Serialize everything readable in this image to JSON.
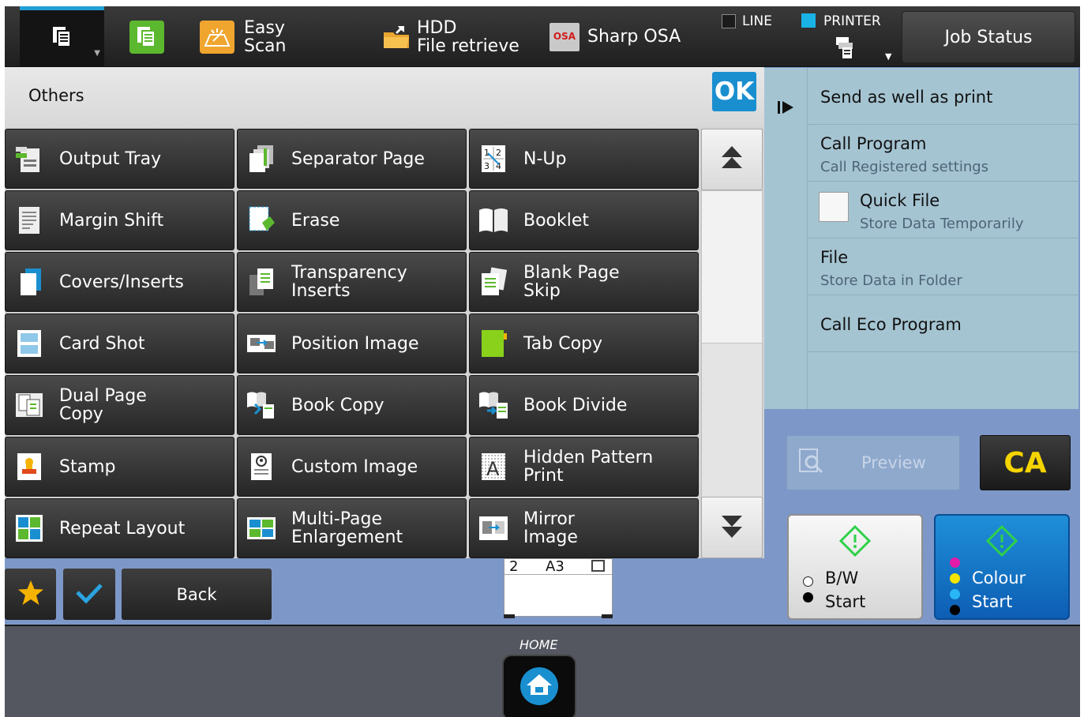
{
  "topbar": {
    "easy_scan": "Easy\nScan",
    "hdd": "HDD\nFile retrieve",
    "sharp_osa": "Sharp OSA",
    "line": "LINE",
    "printer": "PRINTER",
    "job_status": "Job Status",
    "osa_icon_text": "OSA"
  },
  "others": {
    "title": "Others",
    "ok": "OK"
  },
  "functions": [
    [
      "Output Tray",
      "Separator Page",
      "N-Up"
    ],
    [
      "Margin Shift",
      "Erase",
      "Booklet"
    ],
    [
      "Covers/Inserts",
      "Transparency\nInserts",
      "Blank Page\nSkip"
    ],
    [
      "Card Shot",
      "Position Image",
      "Tab Copy"
    ],
    [
      "Dual Page\nCopy",
      "Book Copy",
      "Book Divide"
    ],
    [
      "Stamp",
      "Custom Image",
      "Hidden Pattern\nPrint"
    ],
    [
      "Repeat Layout",
      "Multi-Page\nEnlargement",
      "Mirror\nImage"
    ]
  ],
  "nup_icon": {
    "top": "1",
    "top2": "2",
    "bot": "3",
    "bot2": "4"
  },
  "hidden_pattern_icon": "A",
  "actions": [
    {
      "title": "Send as well as print",
      "sub": ""
    },
    {
      "title": "Call Program",
      "sub": "Call Registered settings"
    },
    {
      "title": "Quick File",
      "sub": "Store Data Temporarily"
    },
    {
      "title": "File",
      "sub": "Store Data in Folder"
    },
    {
      "title": "Call Eco Program",
      "sub": ""
    }
  ],
  "preview": "Preview",
  "ca": "CA",
  "bw_start": "B/W\nStart",
  "colour_start": "Colour\nStart",
  "back": "Back",
  "paper": {
    "tray": "2",
    "size": "A3"
  },
  "home": "HOME",
  "colors": {
    "accent_blue": "#1a8fd0",
    "start_green": "#2fd14a",
    "ca_yellow": "#f5d400",
    "favorite_star": "#f5b300",
    "check_blue": "#2aa3e0"
  }
}
